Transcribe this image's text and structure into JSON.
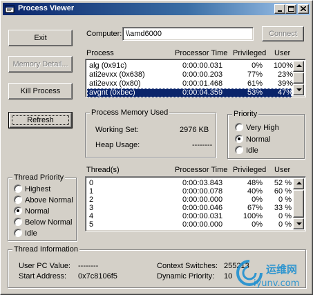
{
  "window": {
    "title": "Process Viewer"
  },
  "buttons": {
    "exit": "Exit",
    "memory_detail": "Memory Detail...",
    "kill_process": "Kill Process",
    "refresh": "Refresh",
    "connect": "Connect"
  },
  "computer": {
    "label": "Computer:",
    "value": "\\\\amd6000"
  },
  "process_list": {
    "columns": [
      "Process",
      "Processor Time",
      "Privileged",
      "User"
    ],
    "rows": [
      {
        "name": "alg (0x91c)",
        "time": "0:00:00.031",
        "priv": "0%",
        "user": "100%"
      },
      {
        "name": "ati2evxx (0x638)",
        "time": "0:00:00.203",
        "priv": "77%",
        "user": "23%"
      },
      {
        "name": "ati2evxx (0x80)",
        "time": "0:00:01.468",
        "priv": "61%",
        "user": "39%"
      },
      {
        "name": "avgnt (0xbec)",
        "time": "0:00:04.359",
        "priv": "53%",
        "user": "47%"
      }
    ],
    "selected_index": 3
  },
  "memory": {
    "title": "Process Memory Used",
    "working_set_label": "Working Set:",
    "working_set_value": "2976 KB",
    "heap_label": "Heap Usage:",
    "heap_value": "--------"
  },
  "priority": {
    "title": "Priority",
    "options": [
      "Very High",
      "Normal",
      "Idle"
    ],
    "selected": "Normal"
  },
  "threads": {
    "columns": [
      "Thread(s)",
      "Processor Time",
      "Privileged",
      "User"
    ],
    "rows": [
      {
        "id": "0",
        "time": "0:00:03.843",
        "priv": "48%",
        "user": "52 %"
      },
      {
        "id": "1",
        "time": "0:00:00.078",
        "priv": "40%",
        "user": "60 %"
      },
      {
        "id": "2",
        "time": "0:00:00.000",
        "priv": "0%",
        "user": "0 %"
      },
      {
        "id": "3",
        "time": "0:00:00.046",
        "priv": "67%",
        "user": "33 %"
      },
      {
        "id": "4",
        "time": "0:00:00.031",
        "priv": "100%",
        "user": "0 %"
      },
      {
        "id": "5",
        "time": "0:00:00.000",
        "priv": "0%",
        "user": "0 %"
      }
    ]
  },
  "thread_priority": {
    "title": "Thread Priority",
    "options": [
      "Highest",
      "Above Normal",
      "Normal",
      "Below Normal",
      "Idle"
    ],
    "selected": "Normal"
  },
  "thread_info": {
    "title": "Thread Information",
    "user_pc_label": "User PC Value:",
    "user_pc_value": "--------",
    "start_address_label": "Start Address:",
    "start_address_value": "0x7c8106f5",
    "context_switches_label": "Context Switches:",
    "context_switches_value": "255213",
    "dynamic_priority_label": "Dynamic Priority:",
    "dynamic_priority_value": "10"
  },
  "watermark": {
    "cn_text": "运维网",
    "url_text": "iyunv.com"
  },
  "colors": {
    "face": "#d4d0c8",
    "selection": "#0a246a",
    "title_start": "#0a246a",
    "title_end": "#a6caf0"
  }
}
